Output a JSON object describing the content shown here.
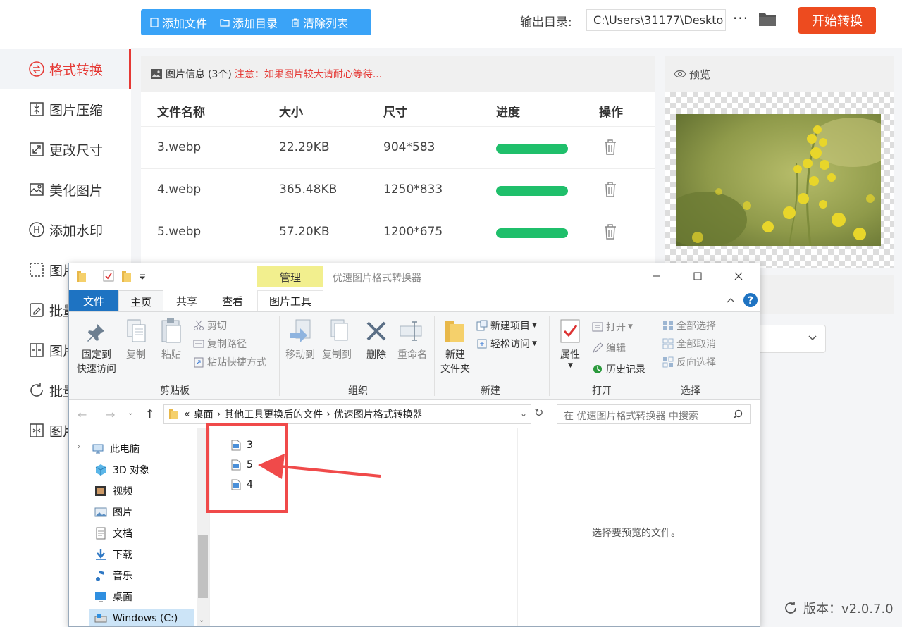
{
  "app": {
    "sidebar": [
      {
        "label": "格式转换",
        "icon": "format-convert-icon",
        "active": true
      },
      {
        "label": "图片压缩",
        "icon": "compress-icon"
      },
      {
        "label": "更改尺寸",
        "icon": "resize-icon"
      },
      {
        "label": "美化图片",
        "icon": "beautify-icon"
      },
      {
        "label": "添加水印",
        "icon": "watermark-icon"
      },
      {
        "label": "图片",
        "icon": "crop-icon"
      },
      {
        "label": "批量",
        "icon": "batch-edit-icon"
      },
      {
        "label": "图片",
        "icon": "split-icon"
      },
      {
        "label": "批量",
        "icon": "rotate-icon"
      },
      {
        "label": "图片",
        "icon": "merge-icon"
      }
    ],
    "toolbar": {
      "add_file": "添加文件",
      "add_dir": "添加目录",
      "clear_list": "清除列表"
    },
    "output": {
      "label": "输出目录:",
      "path": "C:\\Users\\31177\\Deskto",
      "more": "···"
    },
    "start_button": "开始转换",
    "panel": {
      "title": "图片信息",
      "count": "(3个)",
      "warning": "注意：如果图片较大请耐心等待..."
    },
    "table": {
      "headers": [
        "文件名称",
        "大小",
        "尺寸",
        "进度",
        "操作"
      ],
      "rows": [
        {
          "name": "3.webp",
          "size": "22.29KB",
          "dim": "904*583",
          "progress": 1.0
        },
        {
          "name": "4.webp",
          "size": "365.48KB",
          "dim": "1250*833",
          "progress": 1.0
        },
        {
          "name": "5.webp",
          "size": "57.20KB",
          "dim": "1200*675",
          "progress": 1.0
        }
      ]
    },
    "preview_title": "预览",
    "version": "版本：v2.0.7.0",
    "colors": {
      "accent": "#e53935",
      "toolbar_blue": "#3aa3f7",
      "start_orange": "#ed4b1f",
      "progress_green": "#1fbf6b"
    }
  },
  "explorer": {
    "manage_tab": "管理",
    "title": "优速图片格式转换器",
    "tabs": {
      "file": "文件",
      "home": "主页",
      "share": "共享",
      "view": "查看",
      "picture_tools": "图片工具"
    },
    "ribbon": {
      "pin": "固定到\n快速访问",
      "copy": "复制",
      "paste": "粘贴",
      "cut": "剪切",
      "copy_path": "复制路径",
      "paste_shortcut": "粘贴快捷方式",
      "move_to": "移动到",
      "copy_to": "复制到",
      "delete": "删除",
      "rename": "重命名",
      "new_item": "新建项目",
      "easy_access": "轻松访问",
      "new_folder": "新建\n文件夹",
      "properties": "属性",
      "open": "打开",
      "edit": "编辑",
      "history": "历史记录",
      "select_all": "全部选择",
      "select_none": "全部取消",
      "invert": "反向选择",
      "groups": {
        "clipboard": "剪贴板",
        "organize": "组织",
        "new": "新建",
        "open": "打开",
        "select": "选择"
      }
    },
    "address": {
      "prefix": "«",
      "crumbs": [
        "桌面",
        "其他工具更换后的文件",
        "优速图片格式转换器"
      ]
    },
    "search_placeholder": "在 优速图片格式转换器 中搜索",
    "nav": [
      "此电脑",
      "3D 对象",
      "视频",
      "图片",
      "文档",
      "下载",
      "音乐",
      "桌面",
      "Windows (C:)"
    ],
    "files": [
      "3",
      "5",
      "4"
    ],
    "preview_message": "选择要预览的文件。"
  }
}
